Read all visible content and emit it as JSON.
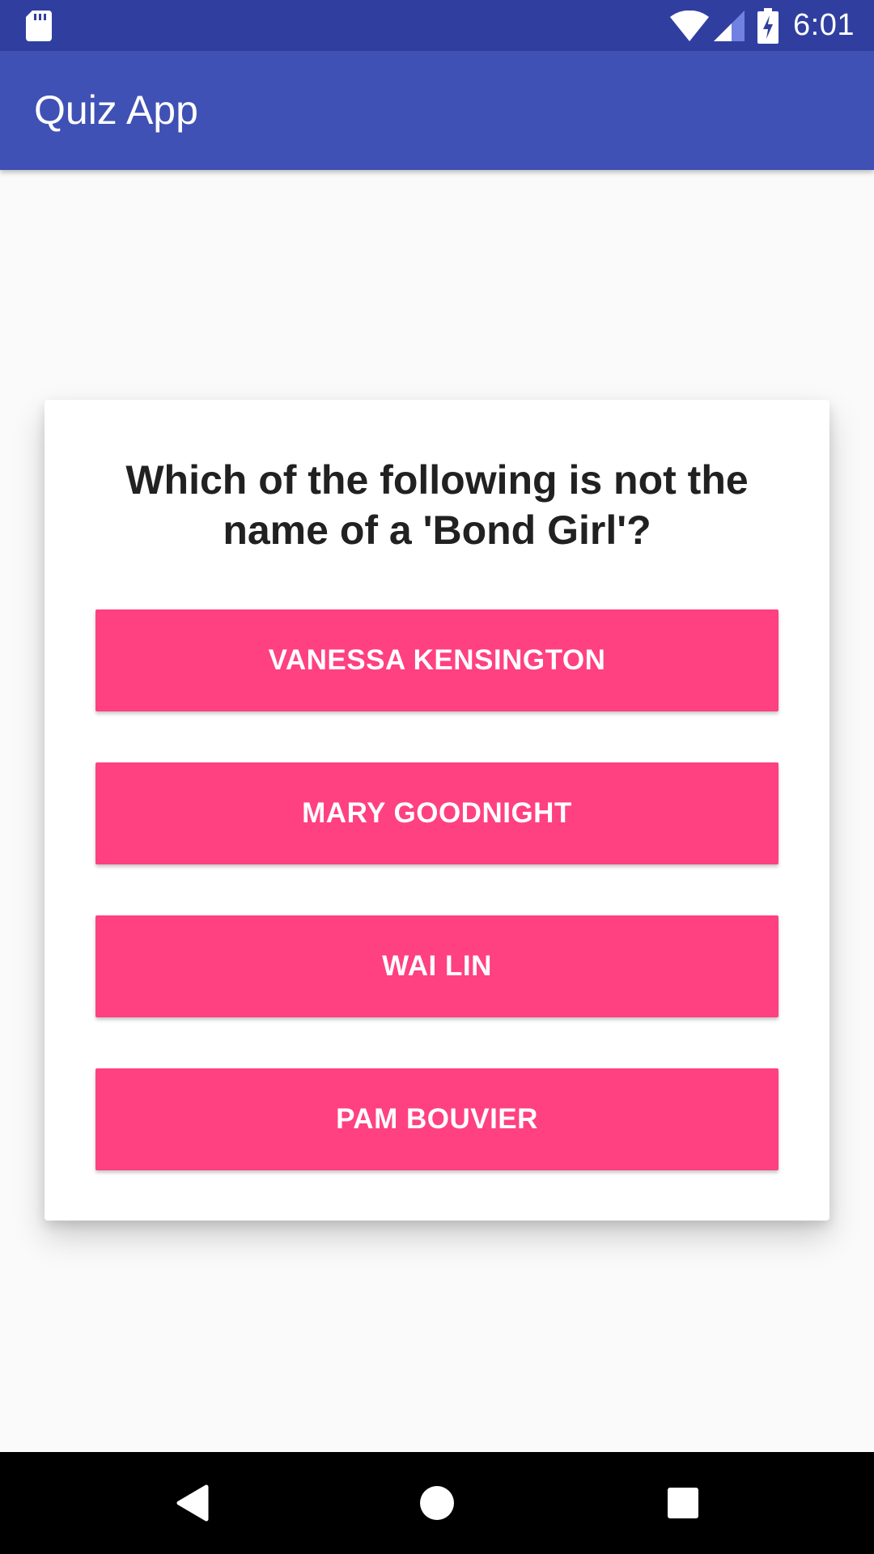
{
  "status_bar": {
    "time": "6:01",
    "icons": [
      "sd-card-icon",
      "wifi-icon",
      "signal-icon",
      "battery-charging-icon"
    ]
  },
  "app_bar": {
    "title": "Quiz App"
  },
  "quiz": {
    "question": "Which of the following is not the name of a 'Bond Girl'?",
    "answers": [
      {
        "label": "VANESSA KENSINGTON"
      },
      {
        "label": "MARY GOODNIGHT"
      },
      {
        "label": "WAI LIN"
      },
      {
        "label": "PAM BOUVIER"
      }
    ]
  },
  "nav_bar": {
    "icons": [
      "back-icon",
      "home-icon",
      "recents-icon"
    ]
  },
  "colors": {
    "status_bar": "#303f9f",
    "app_bar": "#3f51b5",
    "accent": "#ff4081",
    "background": "#fafafa",
    "card": "#ffffff",
    "question_text": "#212121"
  }
}
